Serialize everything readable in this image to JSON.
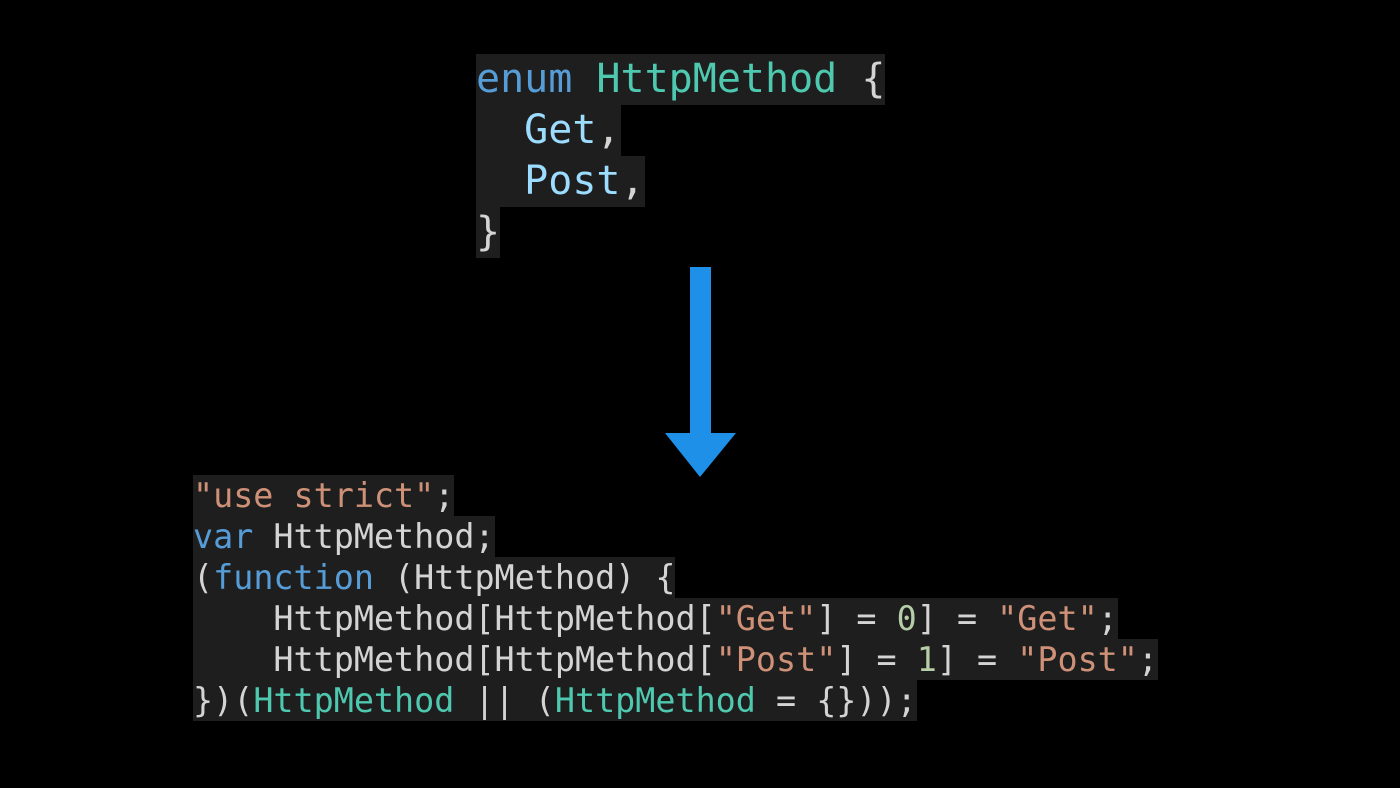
{
  "colors": {
    "background": "#000000",
    "code_background": "#1e1e1e",
    "keyword": "#569cd6",
    "type_name": "#4ec9b0",
    "member": "#9cdcfe",
    "string": "#ce9178",
    "number": "#b5cea8",
    "punctuation": "#d4d4d4",
    "arrow": "#1e90e8"
  },
  "icons": {
    "arrow": "arrow-down-icon"
  },
  "ts_code": {
    "lines": [
      [
        {
          "t": "enum",
          "c": "kw"
        },
        {
          "t": " ",
          "c": "pl"
        },
        {
          "t": "HttpMethod",
          "c": "ty"
        },
        {
          "t": " {",
          "c": "pl"
        }
      ],
      [
        {
          "t": "  ",
          "c": "pl"
        },
        {
          "t": "Get",
          "c": "var"
        },
        {
          "t": ",",
          "c": "pl"
        }
      ],
      [
        {
          "t": "  ",
          "c": "pl"
        },
        {
          "t": "Post",
          "c": "var"
        },
        {
          "t": ",",
          "c": "pl"
        }
      ],
      [
        {
          "t": "}",
          "c": "pl"
        }
      ]
    ]
  },
  "js_code": {
    "lines": [
      [
        {
          "t": "\"use strict\"",
          "c": "str"
        },
        {
          "t": ";",
          "c": "pl"
        }
      ],
      [
        {
          "t": "var",
          "c": "kw"
        },
        {
          "t": " HttpMethod;",
          "c": "pl"
        }
      ],
      [
        {
          "t": "(",
          "c": "pl"
        },
        {
          "t": "function",
          "c": "kw"
        },
        {
          "t": " (HttpMethod) {",
          "c": "pl"
        }
      ],
      [
        {
          "t": "    HttpMethod[HttpMethod[",
          "c": "pl"
        },
        {
          "t": "\"Get\"",
          "c": "str"
        },
        {
          "t": "] = ",
          "c": "pl"
        },
        {
          "t": "0",
          "c": "num"
        },
        {
          "t": "] = ",
          "c": "pl"
        },
        {
          "t": "\"Get\"",
          "c": "str"
        },
        {
          "t": ";",
          "c": "pl"
        }
      ],
      [
        {
          "t": "    HttpMethod[HttpMethod[",
          "c": "pl"
        },
        {
          "t": "\"Post\"",
          "c": "str"
        },
        {
          "t": "] = ",
          "c": "pl"
        },
        {
          "t": "1",
          "c": "num"
        },
        {
          "t": "] = ",
          "c": "pl"
        },
        {
          "t": "\"Post\"",
          "c": "str"
        },
        {
          "t": ";",
          "c": "pl"
        }
      ],
      [
        {
          "t": "})(",
          "c": "pl"
        },
        {
          "t": "HttpMethod",
          "c": "ty"
        },
        {
          "t": " || (",
          "c": "pl"
        },
        {
          "t": "HttpMethod",
          "c": "ty"
        },
        {
          "t": " = {}));",
          "c": "pl"
        }
      ]
    ]
  }
}
